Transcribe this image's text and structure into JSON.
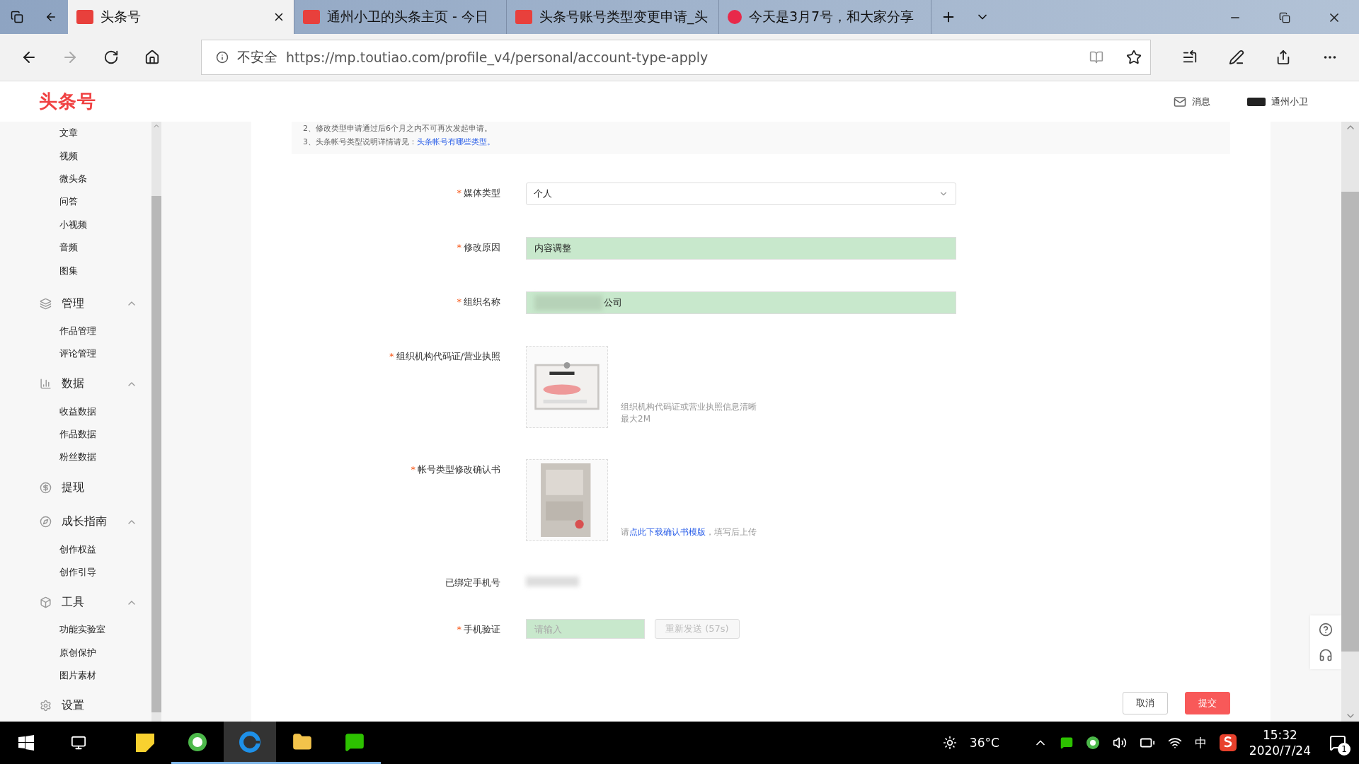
{
  "browser": {
    "tabs": [
      {
        "title": "头条号",
        "selected": true
      },
      {
        "title": "通州小卫的头条主页 - 今日",
        "selected": false
      },
      {
        "title": "头条号账号类型变更申请_头",
        "selected": false
      },
      {
        "title": "今天是3月7号，和大家分享",
        "selected": false
      }
    ],
    "security": "不安全",
    "url": "https://mp.toutiao.com/profile_v4/personal/account-type-apply"
  },
  "header": {
    "logo": "头条号",
    "messages": "消息",
    "user": "通州小卫"
  },
  "sidebar": {
    "items": [
      {
        "kind": "sub",
        "label": "文章"
      },
      {
        "kind": "sub",
        "label": "视频"
      },
      {
        "kind": "sub",
        "label": "微头条"
      },
      {
        "kind": "sub",
        "label": "问答"
      },
      {
        "kind": "sub",
        "label": "小视频"
      },
      {
        "kind": "sub",
        "label": "音频"
      },
      {
        "kind": "sub",
        "label": "图集"
      },
      {
        "kind": "group",
        "label": "管理",
        "expanded": true,
        "children": [
          {
            "label": "作品管理"
          },
          {
            "label": "评论管理"
          }
        ]
      },
      {
        "kind": "group",
        "label": "数据",
        "expanded": true,
        "children": [
          {
            "label": "收益数据"
          },
          {
            "label": "作品数据"
          },
          {
            "label": "粉丝数据"
          }
        ]
      },
      {
        "kind": "link",
        "label": "提现"
      },
      {
        "kind": "group",
        "label": "成长指南",
        "expanded": true,
        "children": [
          {
            "label": "创作权益"
          },
          {
            "label": "创作引导"
          }
        ]
      },
      {
        "kind": "group",
        "label": "工具",
        "expanded": true,
        "children": [
          {
            "label": "功能实验室"
          },
          {
            "label": "原创保护"
          },
          {
            "label": "图片素材"
          }
        ]
      },
      {
        "kind": "link",
        "label": "设置"
      }
    ]
  },
  "notice": [
    {
      "text": "2、修改类型申请通过后6个月之内不可再次发起申请。"
    },
    {
      "text": "3、头条帐号类型说明详情请见：",
      "link": "头条帐号有哪些类型。"
    }
  ],
  "form": [
    {
      "kind": "select",
      "label": "媒体类型",
      "required_mark": "*",
      "value": "个人"
    },
    {
      "kind": "input",
      "label": "修改原因",
      "required_mark": "*",
      "value": "内容调整"
    },
    {
      "kind": "input",
      "label": "组织名称",
      "required_mark": "*",
      "value": "公司",
      "blurred_prefix": true
    },
    {
      "kind": "upload",
      "label": "组织机构代码证/营业执照",
      "required_mark": "*",
      "hint": [
        {
          "text": "组织机构代码证或营业执照信息清晰"
        },
        {
          "text": "最大2M"
        }
      ]
    },
    {
      "kind": "upload",
      "label": "帐号类型修改确认书",
      "required_mark": "*",
      "hint": [
        {
          "text": "请",
          "link": "点此下载确认书模版",
          "after": "，填写后上传"
        }
      ]
    },
    {
      "kind": "static",
      "label": "已绑定手机号"
    },
    {
      "kind": "verify",
      "label": "手机验证",
      "required_mark": "*",
      "placeholder": "请输入",
      "button": "重新发送 (57s)",
      "disabled": true
    }
  ],
  "actions": [
    {
      "label": "取消",
      "primary": false
    },
    {
      "label": "提交",
      "primary": true
    }
  ],
  "taskbar": {
    "weather": "36°C",
    "ime": "中",
    "time": "15:32",
    "date": "2020/7/24",
    "notifications": "1"
  }
}
